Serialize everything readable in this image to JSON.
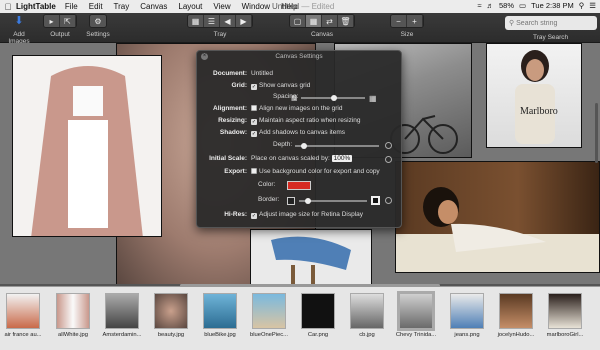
{
  "menubar": {
    "app": "LightTable",
    "items": [
      "File",
      "Edit",
      "Tray",
      "Canvas",
      "Layout",
      "View",
      "Window",
      "Help"
    ],
    "document": "Untitled",
    "edited": "— Edited",
    "battery": "58%",
    "clock": "Tue 2:38 PM"
  },
  "toolbar": {
    "add_images": "Add Images",
    "output": "Output",
    "settings": "Settings",
    "tray": "Tray",
    "canvas": "Canvas",
    "size": "Size",
    "tray_search": "Tray Search",
    "search_placeholder": "Search string"
  },
  "dialog": {
    "title": "Canvas Settings",
    "document_label": "Document:",
    "document_value": "Untitled",
    "grid_label": "Grid:",
    "show_grid": "Show canvas grid",
    "spacing": "Spacing:",
    "alignment_label": "Alignment:",
    "align_new": "Align new images on the grid",
    "resizing_label": "Resizing:",
    "maintain_aspect": "Maintain aspect ratio when resizing",
    "shadow_label": "Shadow:",
    "add_shadows": "Add shadows to canvas items",
    "depth": "Depth:",
    "initial_scale_label": "Initial Scale:",
    "place_scaled": "Place on canvas scaled by:",
    "scale_value": "100%",
    "export_label": "Export:",
    "use_bg": "Use background color for export and copy",
    "color": "Color:",
    "border": "Border:",
    "hires_label": "Hi-Res:",
    "adjust_size": "Adjust image size for Retina Display",
    "color_value": "#d62a22"
  },
  "thumbnails": [
    {
      "name": "air france au..."
    },
    {
      "name": "allWhite.jpg"
    },
    {
      "name": "Amsterdamin..."
    },
    {
      "name": "beauty.jpg"
    },
    {
      "name": "blueBike.jpg"
    },
    {
      "name": "blueOnePiec..."
    },
    {
      "name": "Car.png"
    },
    {
      "name": "cb.jpg"
    },
    {
      "name": "Chevy Trinida..."
    },
    {
      "name": "jeans.png"
    },
    {
      "name": "jocelynHudo..."
    },
    {
      "name": "marlboroGirl..."
    }
  ]
}
